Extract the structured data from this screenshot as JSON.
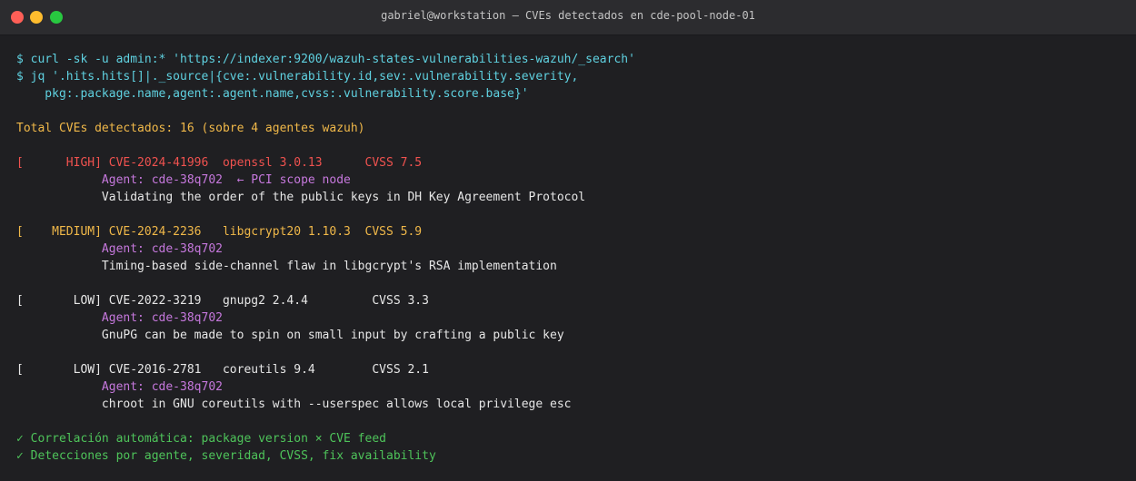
{
  "window": {
    "title": "gabriel@workstation — CVEs detectados en cde-pool-node-01"
  },
  "terminal": {
    "cmd1": "$ curl -sk -u admin:* 'https://indexer:9200/wazuh-states-vulnerabilities-wazuh/_search'",
    "cmd2": "$ jq '.hits.hits[]|._source|{cve:.vulnerability.id,sev:.vulnerability.severity,",
    "cmd2b": "    pkg:.package.name,agent:.agent.name,cvss:.vulnerability.score.base}'",
    "summary": "Total CVEs detectados: 16 (sobre 4 agentes wazuh)",
    "entries": [
      {
        "head": "[      HIGH] CVE-2024-41996  openssl 3.0.13      CVSS 7.5",
        "agent": "            Agent: cde-38q702  ← PCI scope node",
        "desc": "            Validating the order of the public keys in DH Key Agreement Protocol"
      },
      {
        "head": "[    MEDIUM] CVE-2024-2236   libgcrypt20 1.10.3  CVSS 5.9",
        "agent": "            Agent: cde-38q702",
        "desc": "            Timing-based side-channel flaw in libgcrypt's RSA implementation"
      },
      {
        "head": "[       LOW] CVE-2022-3219   gnupg2 2.4.4         CVSS 3.3",
        "agent": "            Agent: cde-38q702",
        "desc": "            GnuPG can be made to spin on small input by crafting a public key"
      },
      {
        "head": "[       LOW] CVE-2016-2781   coreutils 9.4        CVSS 2.1",
        "agent": "            Agent: cde-38q702",
        "desc": "            chroot in GNU coreutils with --userspec allows local privilege esc"
      }
    ],
    "ok1": "✓ Correlación automática: package version × CVE feed",
    "ok2": "✓ Detecciones por agente, severidad, CVSS, fix availability"
  },
  "colors": {
    "background": "#1f1f22",
    "command": "#5fd1e0",
    "summary": "#f0b849",
    "high": "#f0524f",
    "medium": "#f0b849",
    "low": "#e6e6e6",
    "agent": "#c678dd",
    "success": "#4ec35a"
  }
}
